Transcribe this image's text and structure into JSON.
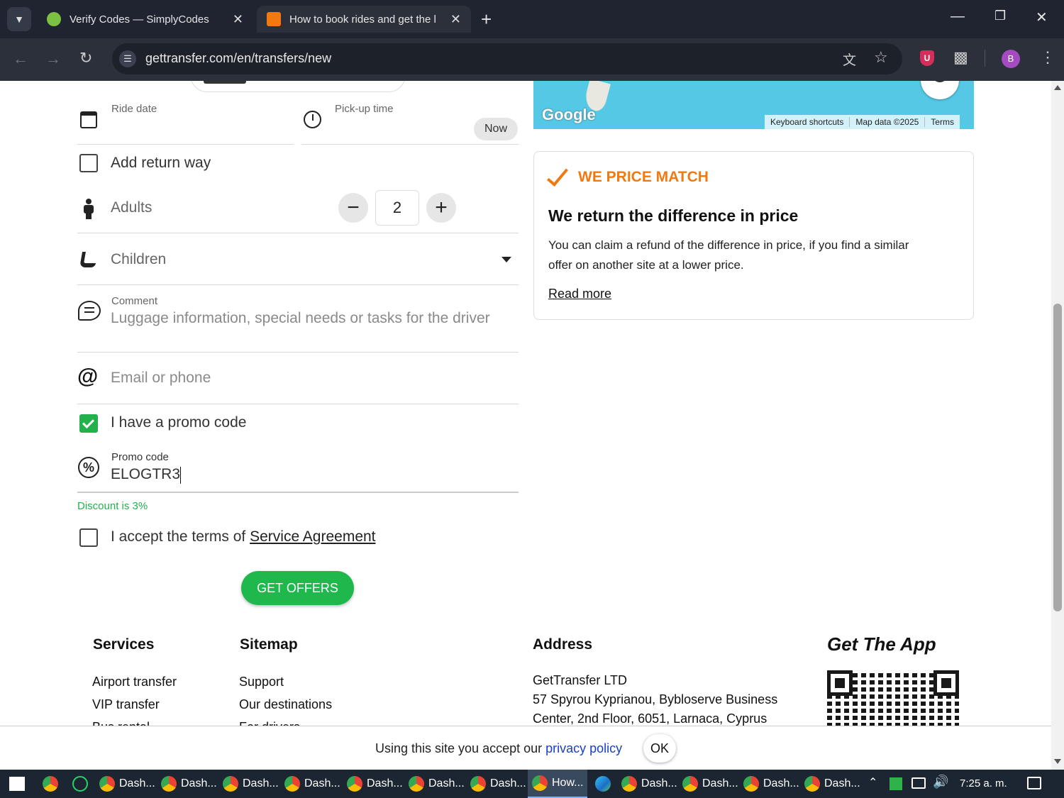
{
  "browser": {
    "tabs": [
      {
        "title": "Verify Codes — SimplyCodes",
        "active": false
      },
      {
        "title": "How to book rides and get the l",
        "active": true
      }
    ],
    "url": "gettransfer.com/en/transfers/new",
    "profile_initial": "B"
  },
  "form": {
    "ride_date_label": "Ride date",
    "pickup_time_label": "Pick-up time",
    "pickup_time_value": "Now",
    "return_label": "Add return way",
    "adults_label": "Adults",
    "adults_value": "2",
    "children_label": "Children",
    "comment_label": "Comment",
    "comment_placeholder": "Luggage information, special needs or tasks for the driver",
    "email_placeholder": "Email or phone",
    "promo_checkbox_label": "I have a promo code",
    "promo_checked": true,
    "promo_label": "Promo code",
    "promo_value": "ELOGTR3",
    "discount_text": "Discount is 3%",
    "terms_prefix": "I accept the terms of ",
    "terms_link": "Service Agreement",
    "submit_label": "GET OFFERS"
  },
  "map": {
    "keyboard_shortcuts": "Keyboard shortcuts",
    "map_data": "Map data ©2025",
    "terms": "Terms",
    "google": "Google"
  },
  "price_match": {
    "heading": "WE PRICE MATCH",
    "title": "We return the difference in price",
    "body_line1": "You can claim a refund of the difference in price, if you find a similar",
    "body_line2": "offer on another site at a lower price.",
    "read_more": "Read more"
  },
  "footer": {
    "services_title": "Services",
    "services": [
      "Airport transfer",
      "VIP transfer",
      "Bus rental"
    ],
    "sitemap_title": "Sitemap",
    "sitemap": [
      "Support",
      "Our destinations",
      "For drivers"
    ],
    "address_title": "Address",
    "address_lines": [
      "GetTransfer LTD",
      "57 Spyrou Kyprianou, Bybloserve Business",
      "Center, 2nd Floor, 6051, Larnaca, Cyprus"
    ],
    "app_title": "Get The App"
  },
  "cookie": {
    "text": "Using this site you accept our ",
    "link": "privacy policy",
    "ok": "OK"
  },
  "taskbar": {
    "items": [
      "Dash...",
      "Dash...",
      "Dash...",
      "Dash...",
      "Dash...",
      "Dash...",
      "Dash...",
      "How...",
      "Dash...",
      "Dash...",
      "Dash...",
      "Dash..."
    ],
    "clock": "7:25 a. m."
  },
  "colors": {
    "accent_orange": "#f07a10",
    "accent_green": "#22b14c",
    "map_water": "#55c8e6"
  }
}
